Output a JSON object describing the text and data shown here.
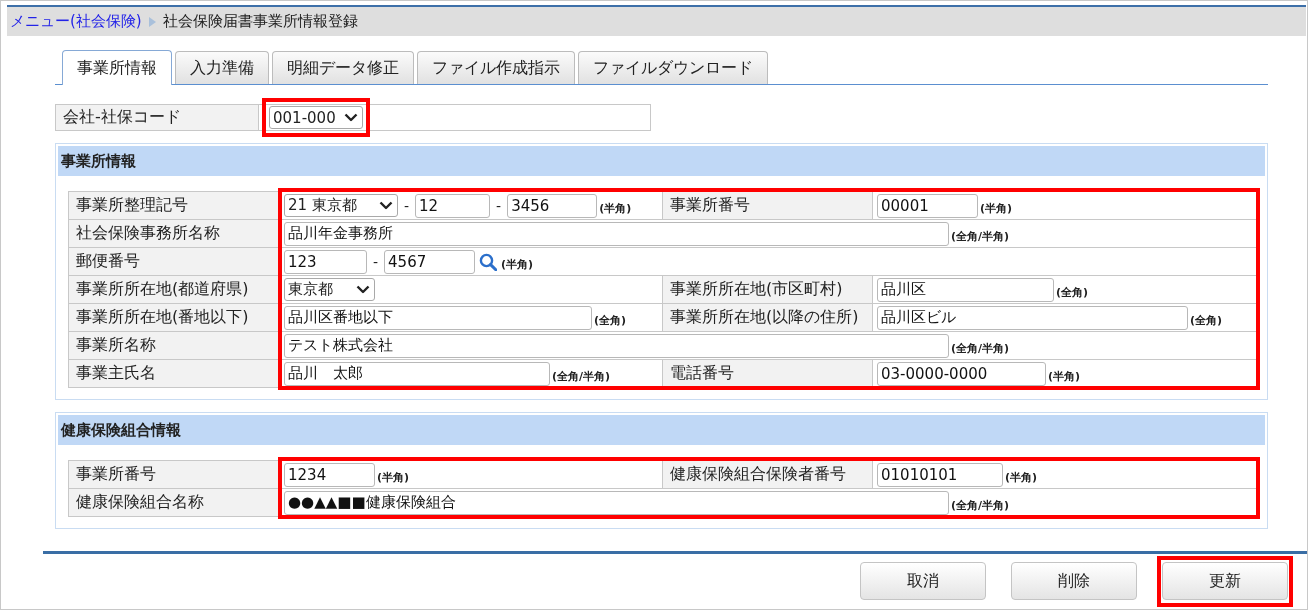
{
  "breadcrumb": {
    "link": "メニュー(社会保険)",
    "current": "社会保険届書事業所情報登録"
  },
  "tabs": [
    {
      "label": "事業所情報",
      "selected": true
    },
    {
      "label": "入力準備",
      "selected": false
    },
    {
      "label": "明細データ修正",
      "selected": false
    },
    {
      "label": "ファイル作成指示",
      "selected": false
    },
    {
      "label": "ファイルダウンロード",
      "selected": false
    }
  ],
  "company_code": {
    "label": "会社-社保コード",
    "value": "001-000",
    "highlighted": true
  },
  "sections": [
    {
      "title": "事業所情報",
      "highlighted": true,
      "rows": [
        {
          "fields": [
            {
              "label": "事業所整理記号",
              "controls": [
                {
                  "kind": "select",
                  "value": "21 東京都"
                },
                {
                  "kind": "dash",
                  "text": "-"
                },
                {
                  "kind": "input",
                  "value": "12"
                },
                {
                  "kind": "dash",
                  "text": "-"
                },
                {
                  "kind": "input",
                  "value": "3456"
                }
              ],
              "note": "(半角)"
            },
            {
              "label": "事業所番号",
              "controls": [
                {
                  "kind": "input",
                  "value": "00001"
                }
              ],
              "note": "(半角)"
            }
          ]
        },
        {
          "fields": [
            {
              "label": "社会保険事務所名称",
              "controls": [
                {
                  "kind": "input",
                  "value": "品川年金事務所"
                }
              ],
              "note": "(全角/半角)"
            }
          ]
        },
        {
          "fields": [
            {
              "label": "郵便番号",
              "controls": [
                {
                  "kind": "input",
                  "value": "123"
                },
                {
                  "kind": "dash",
                  "text": "-"
                },
                {
                  "kind": "input",
                  "value": "4567"
                },
                {
                  "kind": "search"
                }
              ],
              "note": "(半角)"
            }
          ]
        },
        {
          "fields": [
            {
              "label": "事業所所在地(都道府県)",
              "controls": [
                {
                  "kind": "select",
                  "value": "東京都"
                }
              ]
            },
            {
              "label": "事業所所在地(市区町村)",
              "controls": [
                {
                  "kind": "input",
                  "value": "品川区"
                }
              ],
              "note": "(全角)"
            }
          ]
        },
        {
          "fields": [
            {
              "label": "事業所所在地(番地以下)",
              "controls": [
                {
                  "kind": "input",
                  "value": "品川区番地以下"
                }
              ],
              "note": "(全角)"
            },
            {
              "label": "事業所所在地(以降の住所)",
              "controls": [
                {
                  "kind": "input",
                  "value": "品川区ビル"
                }
              ],
              "note": "(全角)"
            }
          ]
        },
        {
          "fields": [
            {
              "label": "事業所名称",
              "controls": [
                {
                  "kind": "input",
                  "value": "テスト株式会社"
                }
              ],
              "note": "(全角/半角)"
            }
          ]
        },
        {
          "fields": [
            {
              "label": "事業主氏名",
              "controls": [
                {
                  "kind": "input",
                  "value": "品川　太郎"
                }
              ],
              "note": "(全角/半角)"
            },
            {
              "label": "電話番号",
              "controls": [
                {
                  "kind": "input",
                  "value": "03-0000-0000"
                }
              ],
              "note": "(半角)"
            }
          ]
        }
      ]
    },
    {
      "title": "健康保険組合情報",
      "highlighted": true,
      "rows": [
        {
          "fields": [
            {
              "label": "事業所番号",
              "controls": [
                {
                  "kind": "input",
                  "value": "1234"
                }
              ],
              "note": "(半角)"
            },
            {
              "label": "健康保険組合保険者番号",
              "controls": [
                {
                  "kind": "input",
                  "value": "01010101"
                }
              ],
              "note": "(半角)"
            }
          ]
        },
        {
          "fields": [
            {
              "label": "健康保険組合名称",
              "controls": [
                {
                  "kind": "input",
                  "value": "●●▲▲■■健康保険組合"
                }
              ],
              "note": "(全角/半角)"
            }
          ]
        }
      ]
    }
  ],
  "buttons": [
    {
      "label": "取消",
      "highlighted": false
    },
    {
      "label": "削除",
      "highlighted": false
    },
    {
      "label": "更新",
      "highlighted": true
    }
  ]
}
